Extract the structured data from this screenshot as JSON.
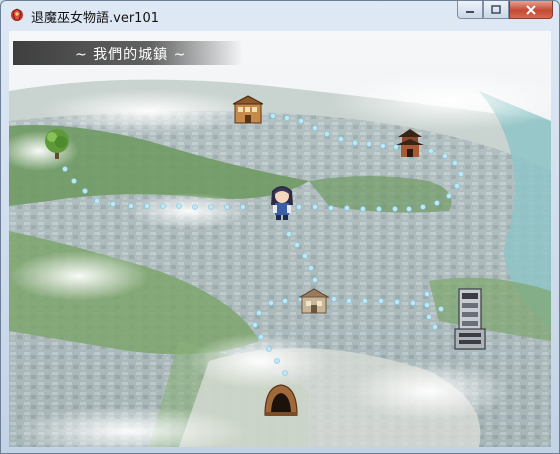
{
  "window": {
    "title": "退魔巫女物語.ver101",
    "controls": {
      "minimize": "minimize-icon",
      "maximize": "maximize-icon",
      "close": "close-icon"
    }
  },
  "map": {
    "location_label": "~ 我們的城鎮 ~",
    "colors": {
      "path_dots": "#bfe8f7",
      "hill_green": "#6f9a63",
      "river": "#8ec4c7"
    },
    "locations": [
      {
        "id": "tree",
        "icon": "tree-icon"
      },
      {
        "id": "shrine-building",
        "icon": "building-icon"
      },
      {
        "id": "pagoda",
        "icon": "pagoda-icon"
      },
      {
        "id": "player",
        "icon": "shrine-maiden-sprite"
      },
      {
        "id": "town-house",
        "icon": "house-icon"
      },
      {
        "id": "office-tower",
        "icon": "tower-icon"
      },
      {
        "id": "cave",
        "icon": "cave-icon"
      }
    ]
  }
}
